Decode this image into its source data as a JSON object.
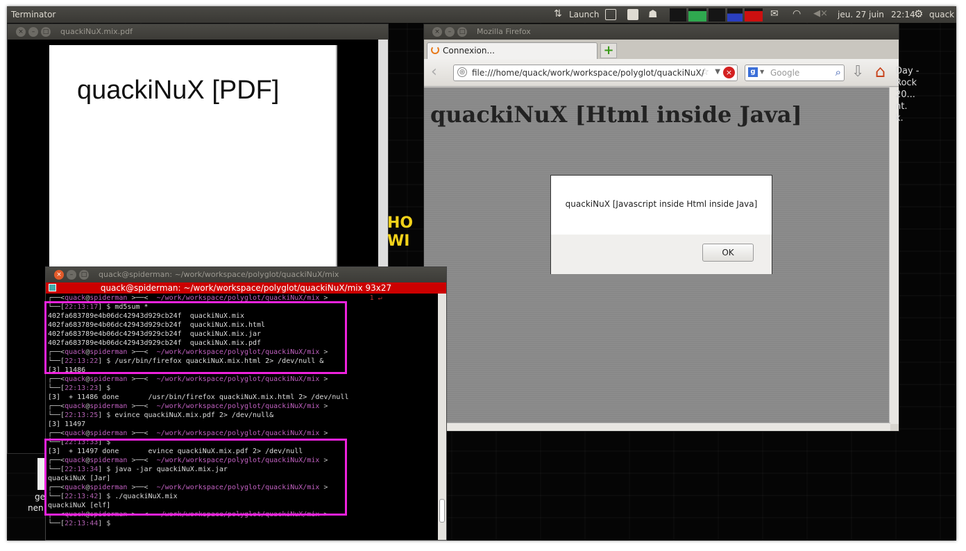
{
  "panel": {
    "app_title": "Terminator",
    "launch_label": "Launch",
    "date": "jeu. 27 juin",
    "time": "22:14",
    "user": "quack"
  },
  "evince": {
    "title": "quackiNuX.mix.pdf",
    "pdf_text": "quackiNuX [PDF]"
  },
  "firefox": {
    "title": "Mozilla Firefox",
    "tab_label": "Connexion...",
    "url": "file:///home/quack/work/workspace/polyglot/quackiNuX/",
    "search_placeholder": "Google",
    "heading": "quackiNuX [Html inside Java]",
    "dialog_message": "quackiNuX [Javascript inside Html inside Java]",
    "ok_label": "OK"
  },
  "terminal": {
    "title": "quack@spiderman: ~/work/workspace/polyglot/quackiNuX/mix",
    "header": "quack@spiderman: ~/work/workspace/polyglot/quackiNuX/mix 93x27",
    "user": "quack",
    "host": "spiderman",
    "path": "~/work/workspace/polyglot/quackiNuX/mix",
    "right_indicator": "1 ↵",
    "lines": [
      {
        "kind": "prompt-top"
      },
      {
        "kind": "cmd",
        "time": "22:13:17",
        "command": "md5sum *"
      },
      {
        "kind": "out",
        "text": "402fa683789e4b06dc42943d929cb24f  quackiNuX.mix"
      },
      {
        "kind": "out",
        "text": "402fa683789e4b06dc42943d929cb24f  quackiNuX.mix.html"
      },
      {
        "kind": "out",
        "text": "402fa683789e4b06dc42943d929cb24f  quackiNuX.mix.jar"
      },
      {
        "kind": "out",
        "text": "402fa683789e4b06dc42943d929cb24f  quackiNuX.mix.pdf"
      },
      {
        "kind": "prompt-top"
      },
      {
        "kind": "cmd",
        "time": "22:13:22",
        "command": "/usr/bin/firefox quackiNuX.mix.html 2> /dev/null &"
      },
      {
        "kind": "out",
        "text": "[3] 11486"
      },
      {
        "kind": "prompt-top"
      },
      {
        "kind": "cmd",
        "time": "22:13:23",
        "command": ""
      },
      {
        "kind": "out",
        "text": "[3]  + 11486 done       /usr/bin/firefox quackiNuX.mix.html 2> /dev/null"
      },
      {
        "kind": "prompt-top"
      },
      {
        "kind": "cmd",
        "time": "22:13:25",
        "command": "evince quackiNuX.mix.pdf 2> /dev/null&"
      },
      {
        "kind": "out",
        "text": "[3] 11497"
      },
      {
        "kind": "prompt-top"
      },
      {
        "kind": "cmd",
        "time": "22:13:33",
        "command": ""
      },
      {
        "kind": "out",
        "text": "[3]  + 11497 done       evince quackiNuX.mix.pdf 2> /dev/null"
      },
      {
        "kind": "prompt-top"
      },
      {
        "kind": "cmd",
        "time": "22:13:34",
        "command": "java -jar quackiNuX.mix.jar"
      },
      {
        "kind": "out",
        "text": "quackiNuX [Jar]"
      },
      {
        "kind": "prompt-top"
      },
      {
        "kind": "cmd",
        "time": "22:13:42",
        "command": "./quackiNuX.mix"
      },
      {
        "kind": "out",
        "text": "quackiNuX [elf]"
      },
      {
        "kind": "prompt-top"
      },
      {
        "kind": "cmd",
        "time": "22:13:44",
        "command": ""
      }
    ]
  },
  "desktop": {
    "right_text": [
      "Day -",
      "Rock",
      "20...",
      "",
      "",
      "nt.",
      "",
      "",
      "",
      "",
      "k."
    ],
    "left_text": [
      "ge",
      "nen"
    ]
  }
}
